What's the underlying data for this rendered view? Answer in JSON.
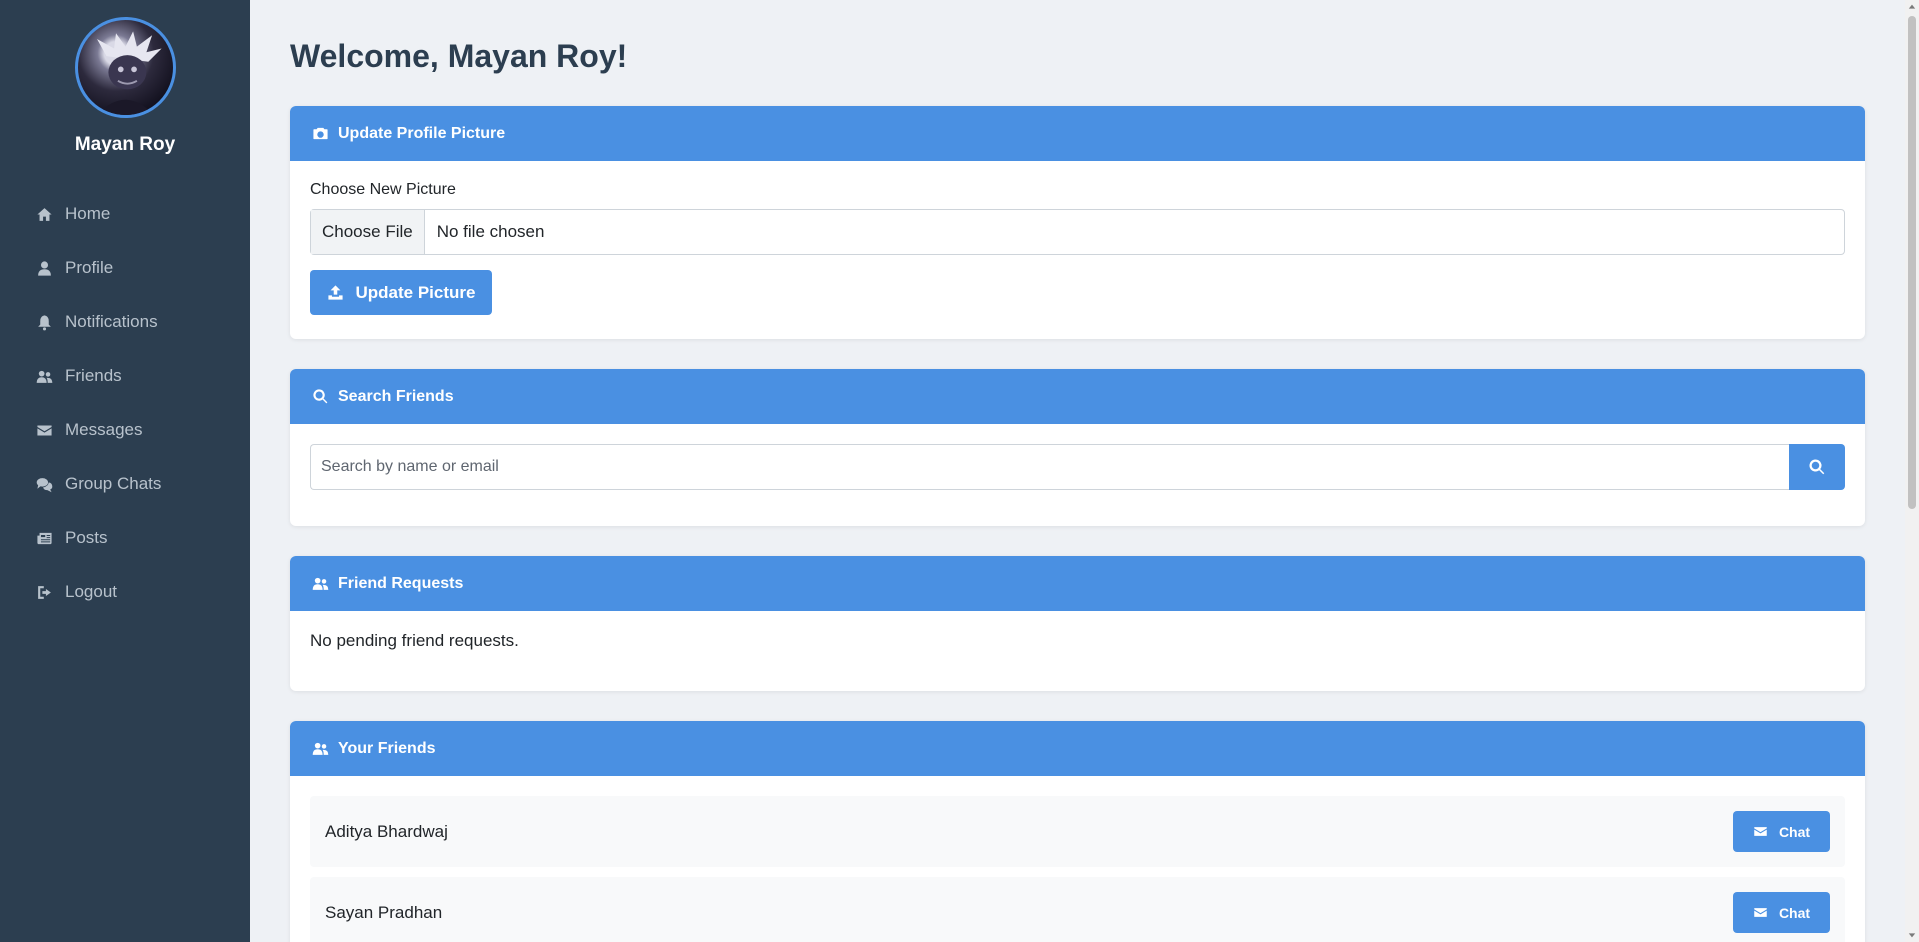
{
  "sidebar": {
    "user_name": "Mayan Roy",
    "items": [
      {
        "label": "Home",
        "icon": "home-icon"
      },
      {
        "label": "Profile",
        "icon": "user-icon"
      },
      {
        "label": "Notifications",
        "icon": "bell-icon"
      },
      {
        "label": "Friends",
        "icon": "users-icon"
      },
      {
        "label": "Messages",
        "icon": "envelope-icon"
      },
      {
        "label": "Group Chats",
        "icon": "comments-icon"
      },
      {
        "label": "Posts",
        "icon": "newspaper-icon"
      },
      {
        "label": "Logout",
        "icon": "sign-out-icon"
      }
    ]
  },
  "main": {
    "welcome": "Welcome, Mayan Roy!",
    "update_picture": {
      "header": "Update Profile Picture",
      "label": "Choose New Picture",
      "file_button": "Choose File",
      "file_status": "No file chosen",
      "submit": "Update Picture"
    },
    "search": {
      "header": "Search Friends",
      "placeholder": "Search by name or email"
    },
    "requests": {
      "header": "Friend Requests",
      "empty": "No pending friend requests."
    },
    "friends": {
      "header": "Your Friends",
      "chat_label": "Chat",
      "list": [
        {
          "name": "Aditya Bhardwaj"
        },
        {
          "name": "Sayan Pradhan"
        }
      ]
    }
  },
  "colors": {
    "sidebar_bg": "#2c3e50",
    "accent": "#4a90e2",
    "page_bg": "#eef1f5"
  }
}
